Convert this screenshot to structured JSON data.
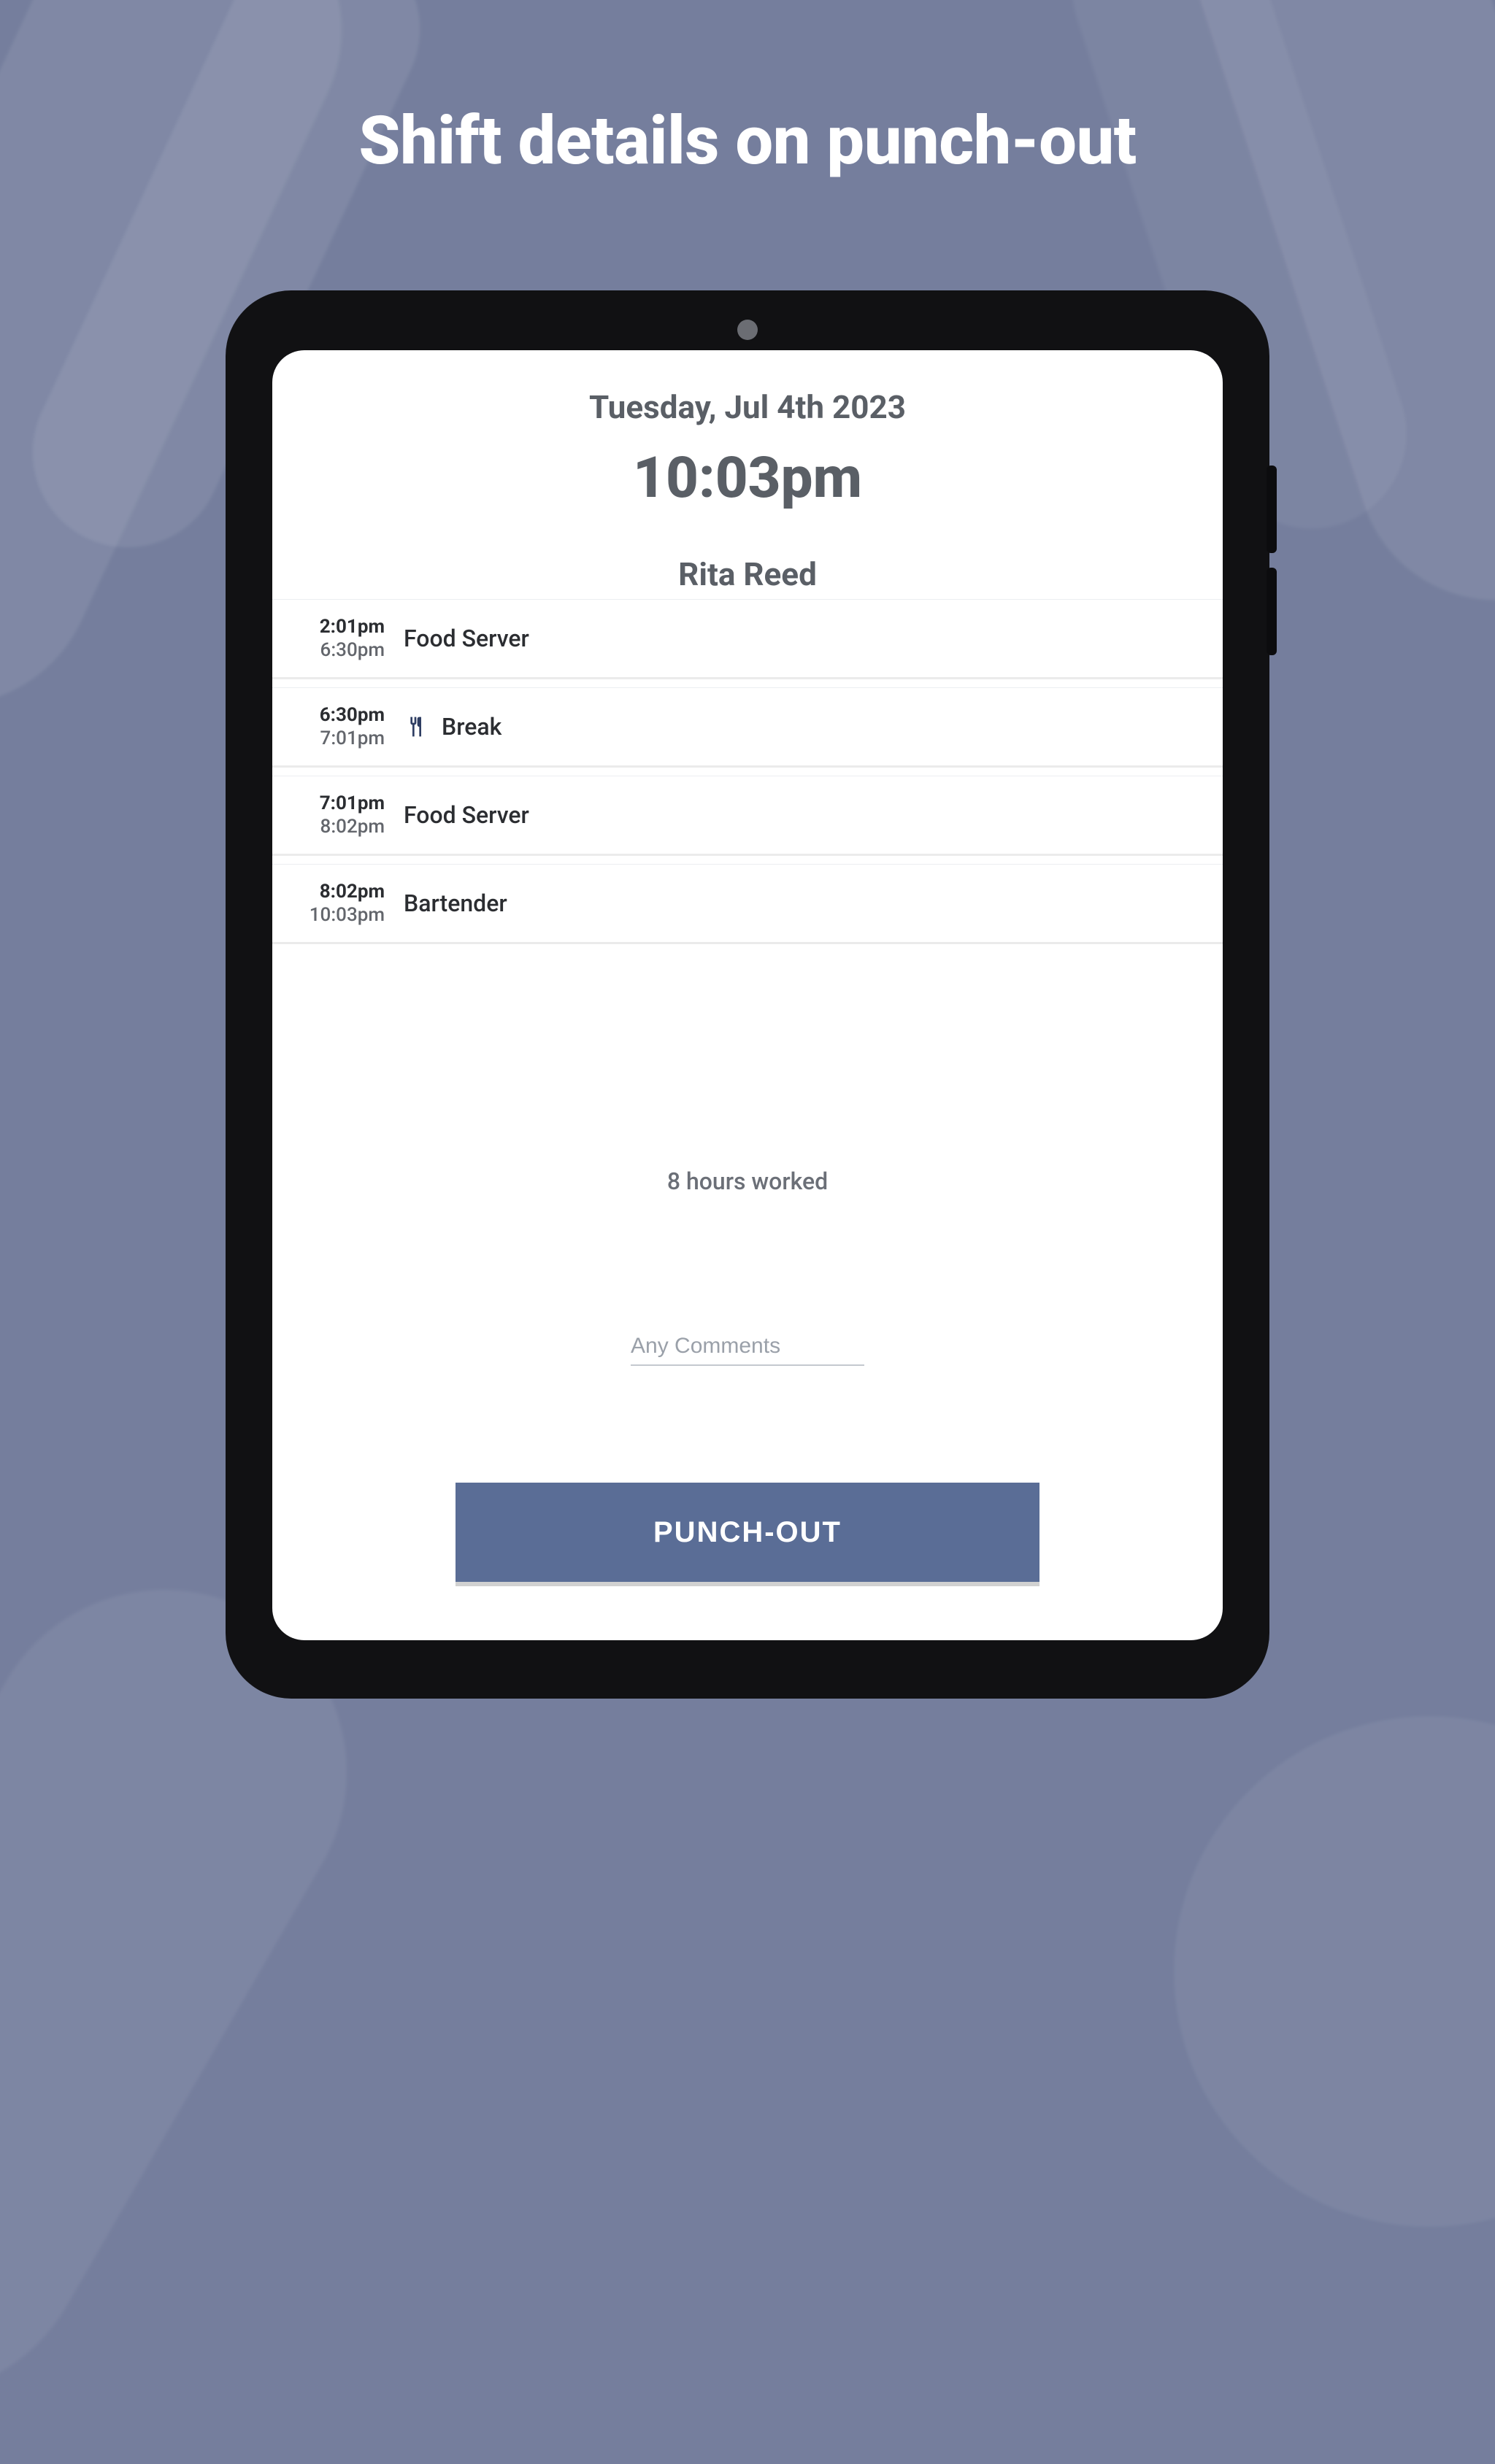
{
  "page": {
    "title": "Shift details on punch-out"
  },
  "header": {
    "date": "Tuesday, Jul 4th 2023",
    "time": "10:03pm",
    "user_name": "Rita Reed"
  },
  "entries": [
    {
      "start": "2:01pm",
      "end": "6:30pm",
      "label": "Food Server",
      "icon": null
    },
    {
      "start": "6:30pm",
      "end": "7:01pm",
      "label": "Break",
      "icon": "utensils-icon"
    },
    {
      "start": "7:01pm",
      "end": "8:02pm",
      "label": "Food Server",
      "icon": null
    },
    {
      "start": "8:02pm",
      "end": "10:03pm",
      "label": "Bartender",
      "icon": null
    }
  ],
  "summary": {
    "hours_worked": "8 hours worked"
  },
  "comments": {
    "placeholder": "Any Comments",
    "value": ""
  },
  "actions": {
    "punch_out_label": "PUNCH-OUT"
  },
  "colors": {
    "accent": "#5a6d96",
    "background": "#757e9d"
  }
}
